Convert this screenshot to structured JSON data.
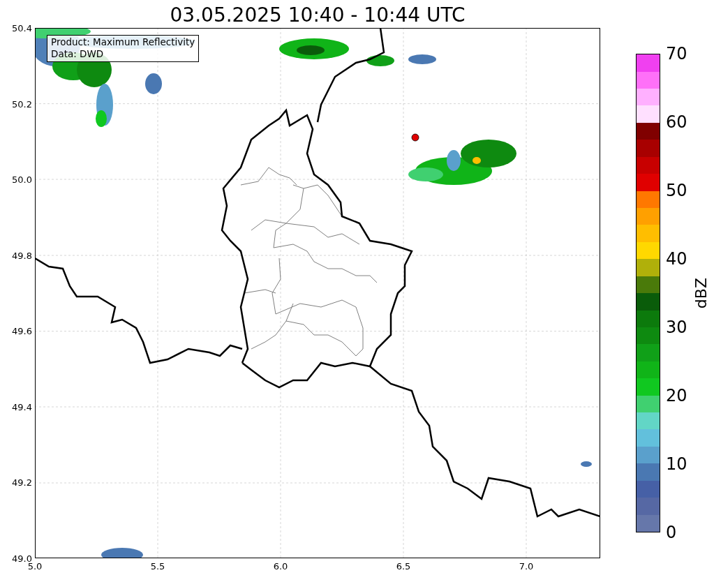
{
  "title": "03.05.2025 10:40 - 10:44 UTC",
  "info_box": {
    "lines": [
      "Product: Maximum Reflectivity",
      "Data: DWD"
    ]
  },
  "map": {
    "x_ticks": [
      "5.0",
      "5.5",
      "6.0",
      "6.5",
      "7.0"
    ],
    "y_ticks": [
      "50.4",
      "50.2",
      "50.0",
      "49.8",
      "49.6",
      "49.4",
      "49.2",
      "49.0"
    ]
  },
  "colorbar": {
    "label": "dBZ",
    "ticks": [
      "70",
      "60",
      "50",
      "40",
      "30",
      "20",
      "10",
      "0"
    ],
    "segments": [
      {
        "color": "#6677aa"
      },
      {
        "color": "#5668a4"
      },
      {
        "color": "#4660a6"
      },
      {
        "color": "#4a78b2"
      },
      {
        "color": "#5aa0cc"
      },
      {
        "color": "#62c0dc"
      },
      {
        "color": "#62d6c6"
      },
      {
        "color": "#40d070"
      },
      {
        "color": "#10c820"
      },
      {
        "color": "#10b418"
      },
      {
        "color": "#10a018"
      },
      {
        "color": "#0e8a10"
      },
      {
        "color": "#0c7a0c"
      },
      {
        "color": "#0a5c0a"
      },
      {
        "color": "#4a7a0a"
      },
      {
        "color": "#b0b00a"
      },
      {
        "color": "#ffd800"
      },
      {
        "color": "#ffbe00"
      },
      {
        "color": "#ffa000"
      },
      {
        "color": "#ff7800"
      },
      {
        "color": "#e00000"
      },
      {
        "color": "#c80000"
      },
      {
        "color": "#a80000"
      },
      {
        "color": "#800000"
      },
      {
        "color": "#ffe0ff"
      },
      {
        "color": "#ffb0ff"
      },
      {
        "color": "#ff70f8"
      },
      {
        "color": "#f040f0"
      }
    ]
  }
}
